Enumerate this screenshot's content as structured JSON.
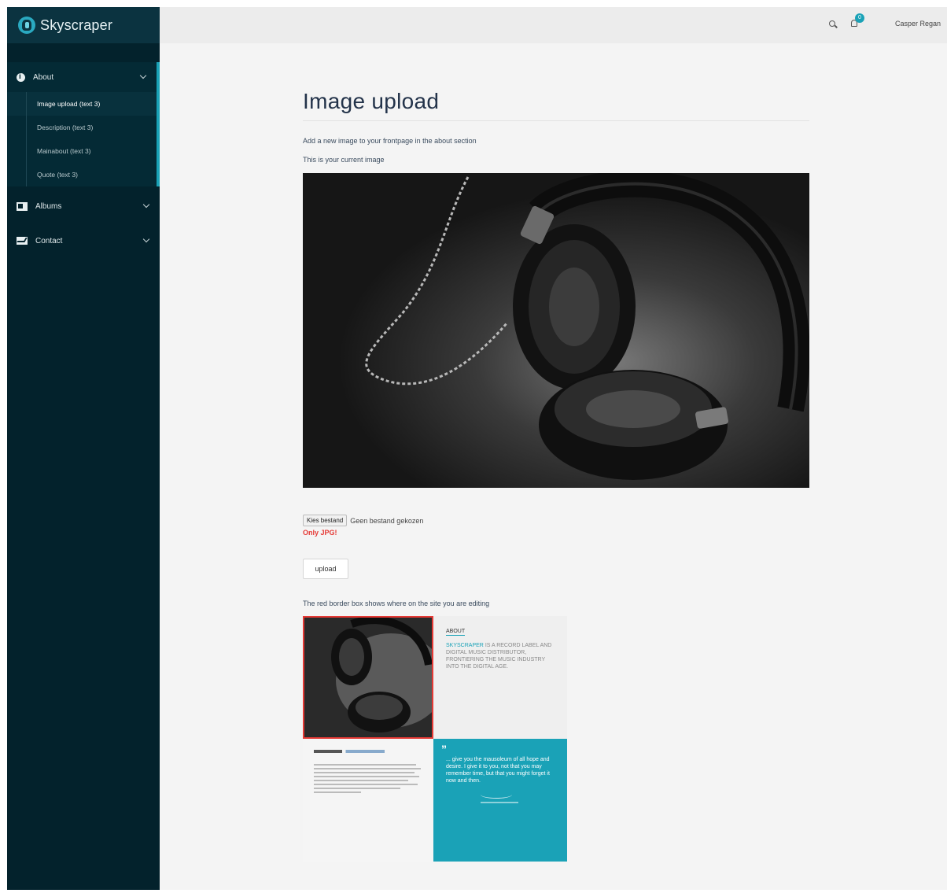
{
  "app": {
    "brand": "Skyscraper",
    "accent_color": "#1aa2b7",
    "sidebar_color": "#03222c"
  },
  "sidebar": {
    "sections": [
      {
        "label": "About",
        "icon": "info-icon",
        "expanded": true,
        "items": [
          {
            "label": "Image upload (text 3)",
            "active": true
          },
          {
            "label": "Description (text 3)",
            "active": false
          },
          {
            "label": "Mainabout (text 3)",
            "active": false
          },
          {
            "label": "Quote (text 3)",
            "active": false
          }
        ]
      },
      {
        "label": "Albums",
        "icon": "album-icon",
        "expanded": false
      },
      {
        "label": "Contact",
        "icon": "mail-icon",
        "expanded": false
      }
    ]
  },
  "topbar": {
    "notification_count": "0",
    "user_name": "Casper Regan"
  },
  "main": {
    "title": "Image upload",
    "lead": "Add a new image to your frontpage in the about section",
    "current_label": "This is your current image",
    "file_button": "Kies bestand",
    "file_status": "Geen bestand gekozen",
    "file_hint": "Only JPG!",
    "upload_label": "upload",
    "preview_caption": "The red border box shows where on the site you are editing"
  },
  "preview": {
    "about_title": "ABOUT",
    "about_brand": "SKYSCRAPER",
    "about_text": "is a record label and digital music distributor, frontiering the music industry into the digital age.",
    "quote_mark": "”",
    "quote_text": "... give you the mausoleum of all hope and desire. I give it to you, not that you may remember time, but that you might forget it now and then."
  }
}
